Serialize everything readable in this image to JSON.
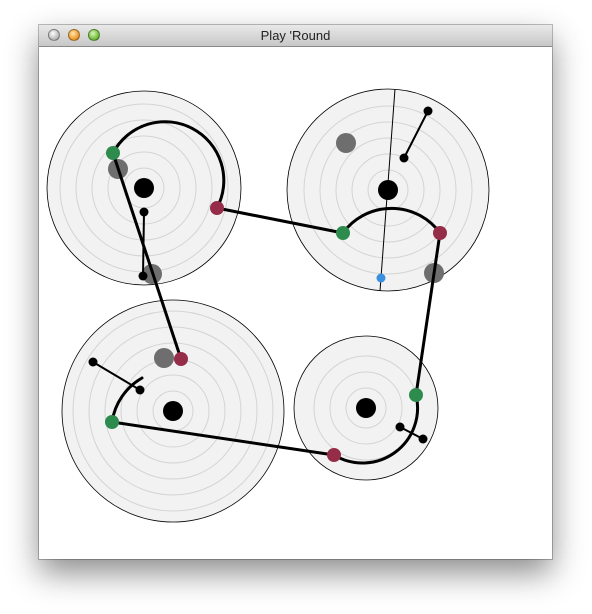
{
  "window": {
    "title": "Play 'Round"
  },
  "colors": {
    "disc_fill": "#f2f2f2",
    "ring_stroke": "#d4d4d4",
    "path": "#000000",
    "start_node": "#2e8b4e",
    "end_node": "#952d48",
    "ghost_node": "#6e6e6e",
    "blue_node": "#3b8fe0"
  },
  "icons": [
    "close-button-icon",
    "minimize-button-icon",
    "zoom-button-icon"
  ]
}
